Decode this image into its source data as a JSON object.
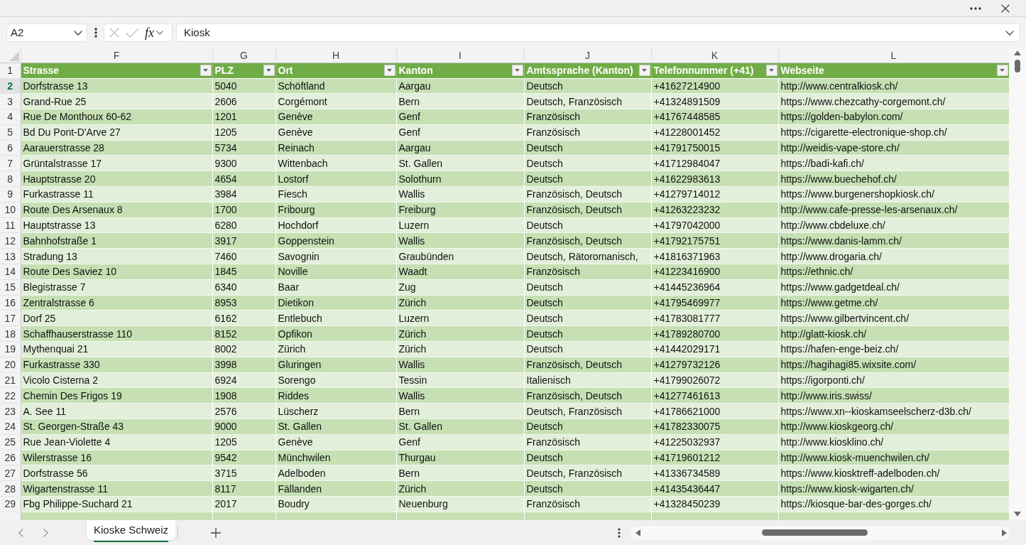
{
  "formula_bar": {
    "name_box": "A2",
    "cancel_button": {
      "disabled": true
    },
    "enter_button": {
      "disabled": true
    },
    "function_button": "fx",
    "formula": "Kiosk"
  },
  "sheet": {
    "columns": [
      {
        "letter": "F",
        "title": "Strasse"
      },
      {
        "letter": "G",
        "title": "PLZ"
      },
      {
        "letter": "H",
        "title": "Ort"
      },
      {
        "letter": "I",
        "title": "Kanton"
      },
      {
        "letter": "J",
        "title": "Amtssprache (Kanton)"
      },
      {
        "letter": "K",
        "title": "Telefonnummer (+41)"
      },
      {
        "letter": "L",
        "title": "Webseite"
      }
    ],
    "header_row": {
      "number": "1",
      "selected": false
    },
    "rows": [
      {
        "number": "2",
        "selected": true,
        "cells": [
          "Dorfstrasse 13",
          "5040",
          "Schöftland",
          "Aargau",
          "Deutsch",
          "+41627214900",
          "http://www.centralkiosk.ch/"
        ]
      },
      {
        "number": "3",
        "selected": false,
        "cells": [
          "Grand-Rue 25",
          "2606",
          "Corgémont",
          "Bern",
          "Deutsch, Französisch",
          "+41324891509",
          "https://www.chezcathy-corgemont.ch/"
        ]
      },
      {
        "number": "4",
        "selected": false,
        "cells": [
          "Rue De Monthoux 60-62",
          "1201",
          "Genève",
          "Genf",
          "Französisch",
          "+41767448585",
          "https://golden-babylon.com/"
        ]
      },
      {
        "number": "5",
        "selected": false,
        "cells": [
          "Bd Du Pont-D'Arve 27",
          "1205",
          "Genève",
          "Genf",
          "Französisch",
          "+41228001452",
          "https://cigarette-electronique-shop.ch/"
        ]
      },
      {
        "number": "6",
        "selected": false,
        "cells": [
          "Aarauerstrasse 28",
          "5734",
          "Reinach",
          "Aargau",
          "Deutsch",
          "+41791750015",
          "http://weidis-vape-store.ch/"
        ]
      },
      {
        "number": "7",
        "selected": false,
        "cells": [
          "Grüntalstrasse 17",
          "9300",
          "Wittenbach",
          "St. Gallen",
          "Deutsch",
          "+41712984047",
          "https://badi-kafi.ch/"
        ]
      },
      {
        "number": "8",
        "selected": false,
        "cells": [
          "Hauptstrasse 20",
          "4654",
          "Lostorf",
          "Solothurn",
          "Deutsch",
          "+41622983613",
          "https://www.buechehof.ch/"
        ]
      },
      {
        "number": "9",
        "selected": false,
        "cells": [
          "Furkastrasse 11",
          "3984",
          "Fiesch",
          "Wallis",
          "Französisch, Deutsch",
          "+41279714012",
          "https://www.burgenershopkiosk.ch/"
        ]
      },
      {
        "number": "10",
        "selected": false,
        "cells": [
          "Route Des Arsenaux 8",
          "1700",
          "Fribourg",
          "Freiburg",
          "Französisch, Deutsch",
          "+41263223232",
          "http://www.cafe-presse-les-arsenaux.ch/"
        ]
      },
      {
        "number": "11",
        "selected": false,
        "cells": [
          "Hauptstrasse 13",
          "6280",
          "Hochdorf",
          "Luzern",
          "Deutsch",
          "+41797042000",
          "http://www.cbdeluxe.ch/"
        ]
      },
      {
        "number": "12",
        "selected": false,
        "cells": [
          "Bahnhofstraße 1",
          "3917",
          "Goppenstein",
          "Wallis",
          "Französisch, Deutsch",
          "+41792175751",
          "https://www.danis-lamm.ch/"
        ]
      },
      {
        "number": "13",
        "selected": false,
        "cells": [
          "Stradung 13",
          "7460",
          "Savognin",
          "Graubünden",
          "Deutsch, Rätoromanisch,",
          "+41816371963",
          "http://www.drogaria.ch/"
        ]
      },
      {
        "number": "14",
        "selected": false,
        "cells": [
          "Route Des Saviez 10",
          "1845",
          "Noville",
          "Waadt",
          "Französisch",
          "+41223416900",
          "https://ethnic.ch/"
        ]
      },
      {
        "number": "15",
        "selected": false,
        "cells": [
          "Blegistrasse 7",
          "6340",
          "Baar",
          "Zug",
          "Deutsch",
          "+41445236964",
          "https://www.gadgetdeal.ch/"
        ]
      },
      {
        "number": "16",
        "selected": false,
        "cells": [
          "Zentralstrasse 6",
          "8953",
          "Dietikon",
          "Zürich",
          "Deutsch",
          "+41795469977",
          "https://www.getme.ch/"
        ]
      },
      {
        "number": "17",
        "selected": false,
        "cells": [
          "Dorf 25",
          "6162",
          "Entlebuch",
          "Luzern",
          "Deutsch",
          "+41783081777",
          "https://www.gilbertvincent.ch/"
        ]
      },
      {
        "number": "18",
        "selected": false,
        "cells": [
          "Schaffhauserstrasse 110",
          "8152",
          "Opfikon",
          "Zürich",
          "Deutsch",
          "+41789280700",
          "http://glatt-kiosk.ch/"
        ]
      },
      {
        "number": "19",
        "selected": false,
        "cells": [
          "Mythenquai 21",
          "8002",
          "Zürich",
          "Zürich",
          "Deutsch",
          "+41442029171",
          "https://hafen-enge-beiz.ch/"
        ]
      },
      {
        "number": "20",
        "selected": false,
        "cells": [
          "Furkastrasse 330",
          "3998",
          "Gluringen",
          "Wallis",
          "Französisch, Deutsch",
          "+41279732126",
          "https://hagihagi85.wixsite.com/"
        ]
      },
      {
        "number": "21",
        "selected": false,
        "cells": [
          "Vicolo Cisterna 2",
          "6924",
          "Sorengo",
          "Tessin",
          "Italienisch",
          "+41799026072",
          "https://igorponti.ch/"
        ]
      },
      {
        "number": "22",
        "selected": false,
        "cells": [
          "Chemin Des Frigos 19",
          "1908",
          "Riddes",
          "Wallis",
          "Französisch, Deutsch",
          "+41277461613",
          "http://www.iris.swiss/"
        ]
      },
      {
        "number": "23",
        "selected": false,
        "cells": [
          "A. See 11",
          "2576",
          "Lüscherz",
          "Bern",
          "Deutsch, Französisch",
          "+41786621000",
          "https://www.xn--kioskamseelscherz-d3b.ch/"
        ]
      },
      {
        "number": "24",
        "selected": false,
        "cells": [
          "St. Georgen-Straße 43",
          "9000",
          "St. Gallen",
          "St. Gallen",
          "Deutsch",
          "+41782330075",
          "http://www.kioskgeorg.ch/"
        ]
      },
      {
        "number": "25",
        "selected": false,
        "cells": [
          "Rue Jean-Violette 4",
          "1205",
          "Genève",
          "Genf",
          "Französisch",
          "+41225032937",
          "http://www.kiosklino.ch/"
        ]
      },
      {
        "number": "26",
        "selected": false,
        "cells": [
          "Wilerstrasse 16",
          "9542",
          "Münchwilen",
          "Thurgau",
          "Deutsch",
          "+41719601212",
          "http://www.kiosk-muenchwilen.ch/"
        ]
      },
      {
        "number": "27",
        "selected": false,
        "cells": [
          "Dorfstrasse 56",
          "3715",
          "Adelboden",
          "Bern",
          "Deutsch, Französisch",
          "+41336734589",
          "https://www.kiosktreff-adelboden.ch/"
        ]
      },
      {
        "number": "28",
        "selected": false,
        "cells": [
          "Wigartenstrasse 11",
          "8117",
          "Fällanden",
          "Zürich",
          "Deutsch",
          "+41435436447",
          "https://www.kiosk-wigarten.ch/"
        ]
      },
      {
        "number": "29",
        "selected": false,
        "cells": [
          "Fbg Philippe-Suchard 21",
          "2017",
          "Boudry",
          "Neuenburg",
          "Französisch",
          "+41328450239",
          "https://kiosque-bar-des-gorges.ch/"
        ]
      }
    ]
  },
  "sheet_tabs": [
    {
      "label": "Kioske Schweiz",
      "selected": true
    }
  ]
}
